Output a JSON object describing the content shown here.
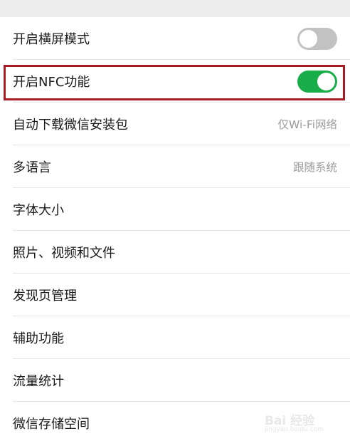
{
  "settings": {
    "items": [
      {
        "label": "开启横屏模式",
        "toggle": "off"
      },
      {
        "label": "开启NFC功能",
        "toggle": "on"
      },
      {
        "label": "自动下载微信安装包",
        "value": "仅Wi-Fi网络"
      },
      {
        "label": "多语言",
        "value": "跟随系统"
      },
      {
        "label": "字体大小"
      },
      {
        "label": "照片、视频和文件"
      },
      {
        "label": "发现页管理"
      },
      {
        "label": "辅助功能"
      },
      {
        "label": "流量统计"
      },
      {
        "label": "微信存储空间"
      }
    ]
  },
  "colors": {
    "toggle_on": "#19ad4a",
    "toggle_off": "#c2c2c2",
    "highlight_border": "#a81d24"
  },
  "watermark": {
    "text": "Bai 经验",
    "sub": "jingyan.baidu.com"
  }
}
